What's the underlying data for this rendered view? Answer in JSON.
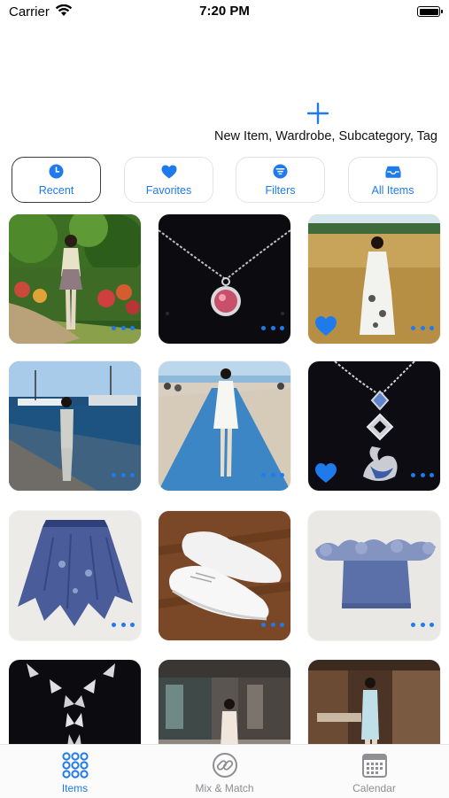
{
  "status_bar": {
    "carrier": "Carrier",
    "time": "7:20 PM",
    "battery_level": 1.0
  },
  "add": {
    "label": "New Item, Wardrobe, Subcategory, Tag",
    "icon": "plus-icon"
  },
  "filters": [
    {
      "label": "Recent",
      "icon": "clock-icon",
      "selected": true
    },
    {
      "label": "Favorites",
      "icon": "heart-icon",
      "selected": false
    },
    {
      "label": "Filters",
      "icon": "filter-icon",
      "selected": false
    },
    {
      "label": "All Items",
      "icon": "tray-icon",
      "selected": false
    }
  ],
  "items": [
    {
      "subject": "garden-photo",
      "favorite": false
    },
    {
      "subject": "pink-pendant-necklace",
      "favorite": false
    },
    {
      "subject": "wheat-field-photo",
      "favorite": true
    },
    {
      "subject": "harbor-photo",
      "favorite": false
    },
    {
      "subject": "beach-path-photo",
      "favorite": false
    },
    {
      "subject": "swan-pendant-necklace",
      "favorite": true
    },
    {
      "subject": "blue-tulle-skirt",
      "favorite": false
    },
    {
      "subject": "white-sneakers",
      "favorite": false
    },
    {
      "subject": "blue-ruffle-top",
      "favorite": false
    },
    {
      "subject": "butterfly-necklace",
      "favorite": false
    },
    {
      "subject": "mall-photo",
      "favorite": false
    },
    {
      "subject": "cabin-photo",
      "favorite": false
    }
  ],
  "tabs": [
    {
      "label": "Items",
      "icon": "grid-icon",
      "active": true
    },
    {
      "label": "Mix & Match",
      "icon": "link-icon",
      "active": false
    },
    {
      "label": "Calendar",
      "icon": "calendar-icon",
      "active": false
    }
  ],
  "colors": {
    "accent": "#1f7aeb",
    "inactive": "#8e8e93",
    "border": "#e3e3e6"
  }
}
